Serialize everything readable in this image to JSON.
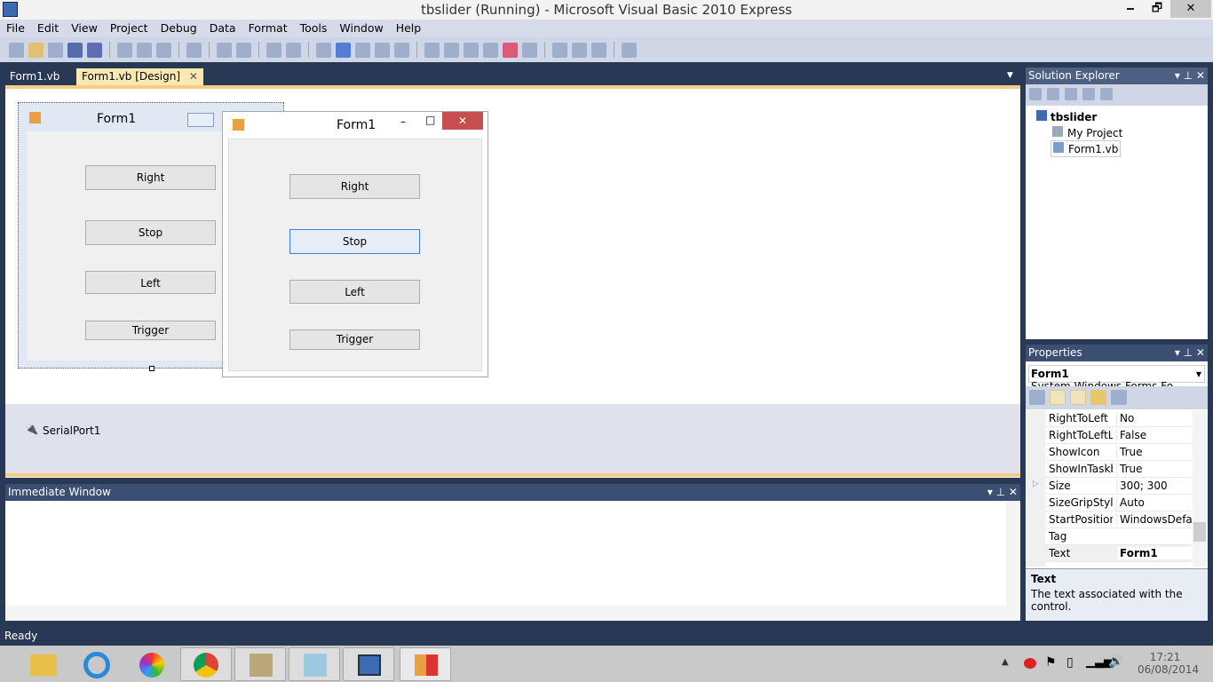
{
  "window": {
    "title": "tbslider (Running) - Microsoft Visual Basic 2010 Express",
    "min": "🗕",
    "max": "🗗",
    "close": "✕"
  },
  "menu": [
    "File",
    "Edit",
    "View",
    "Project",
    "Debug",
    "Data",
    "Format",
    "Tools",
    "Window",
    "Help"
  ],
  "tabs": [
    {
      "label": "Form1.vb"
    },
    {
      "label": "Form1.vb [Design]",
      "close": "✕"
    }
  ],
  "designer": {
    "form_title": "Form1",
    "buttons": [
      "Right",
      "Stop",
      "Left",
      "Trigger"
    ],
    "component": "SerialPort1"
  },
  "running_form": {
    "title": "Form1",
    "min": "–",
    "max": "□",
    "close": "✕",
    "buttons": [
      "Right",
      "Stop",
      "Left",
      "Trigger"
    ]
  },
  "solution_explorer": {
    "title": "Solution Explorer",
    "project": "tbslider",
    "items": [
      "My Project",
      "Form1.vb"
    ]
  },
  "properties": {
    "title": "Properties",
    "object": "Form1",
    "type": "System.Windows.Forms.Fo",
    "rows": [
      {
        "name": "RightToLeft",
        "value": "No"
      },
      {
        "name": "RightToLeftLayout",
        "value": "False"
      },
      {
        "name": "ShowIcon",
        "value": "True"
      },
      {
        "name": "ShowInTaskbar",
        "value": "True"
      },
      {
        "name": "Size",
        "value": "300; 300"
      },
      {
        "name": "SizeGripStyle",
        "value": "Auto"
      },
      {
        "name": "StartPosition",
        "value": "WindowsDefaultLocation"
      },
      {
        "name": "Tag",
        "value": ""
      },
      {
        "name": "Text",
        "value": "Form1"
      }
    ],
    "desc_title": "Text",
    "desc": "The text associated with the control."
  },
  "immediate": {
    "title": "Immediate Window"
  },
  "status": "Ready",
  "clock": {
    "time": "17:21",
    "date": "06/08/2014"
  }
}
